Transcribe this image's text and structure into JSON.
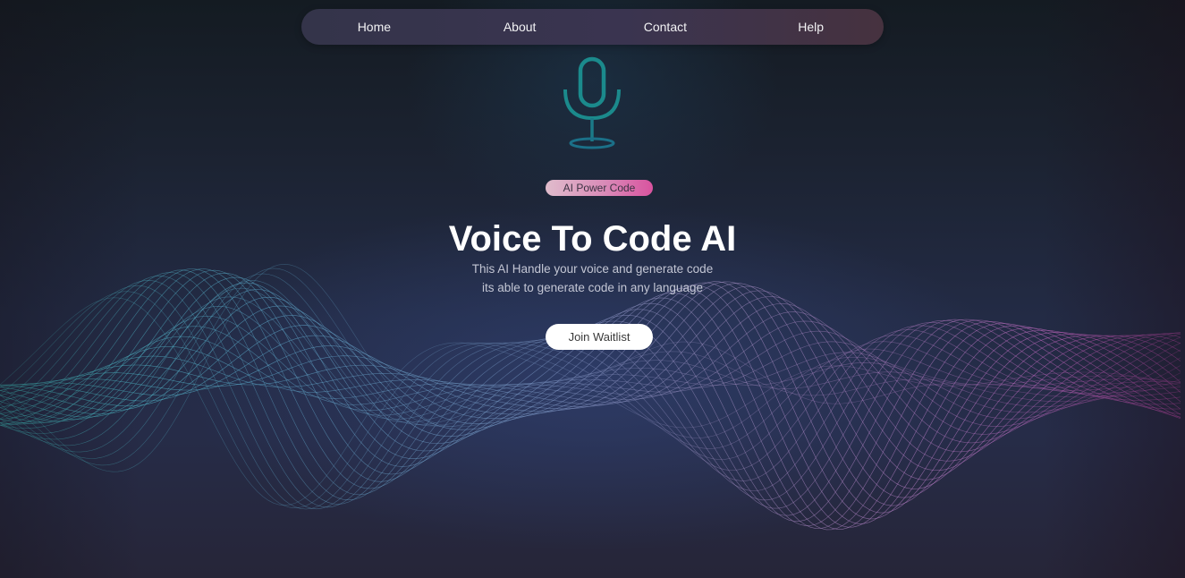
{
  "nav": {
    "items": [
      {
        "label": "Home"
      },
      {
        "label": "About"
      },
      {
        "label": "Contact"
      },
      {
        "label": "Help"
      }
    ]
  },
  "hero": {
    "badge": "AI Power Code",
    "title": "Voice To Code AI",
    "subtitle_line1": "This AI Handle your voice and generate code",
    "subtitle_line2": "its able to generate code in any language",
    "cta_label": "Join Waitlist"
  },
  "icons": {
    "hero_icon": "microphone-icon"
  },
  "colors": {
    "mic": "#1b8a8c",
    "wave_left": "#3fc6c4",
    "wave_middle": "#6f92c8",
    "wave_right": "#d44fbf",
    "badge_end": "#d9539f",
    "cta_background": "#ffffff"
  }
}
